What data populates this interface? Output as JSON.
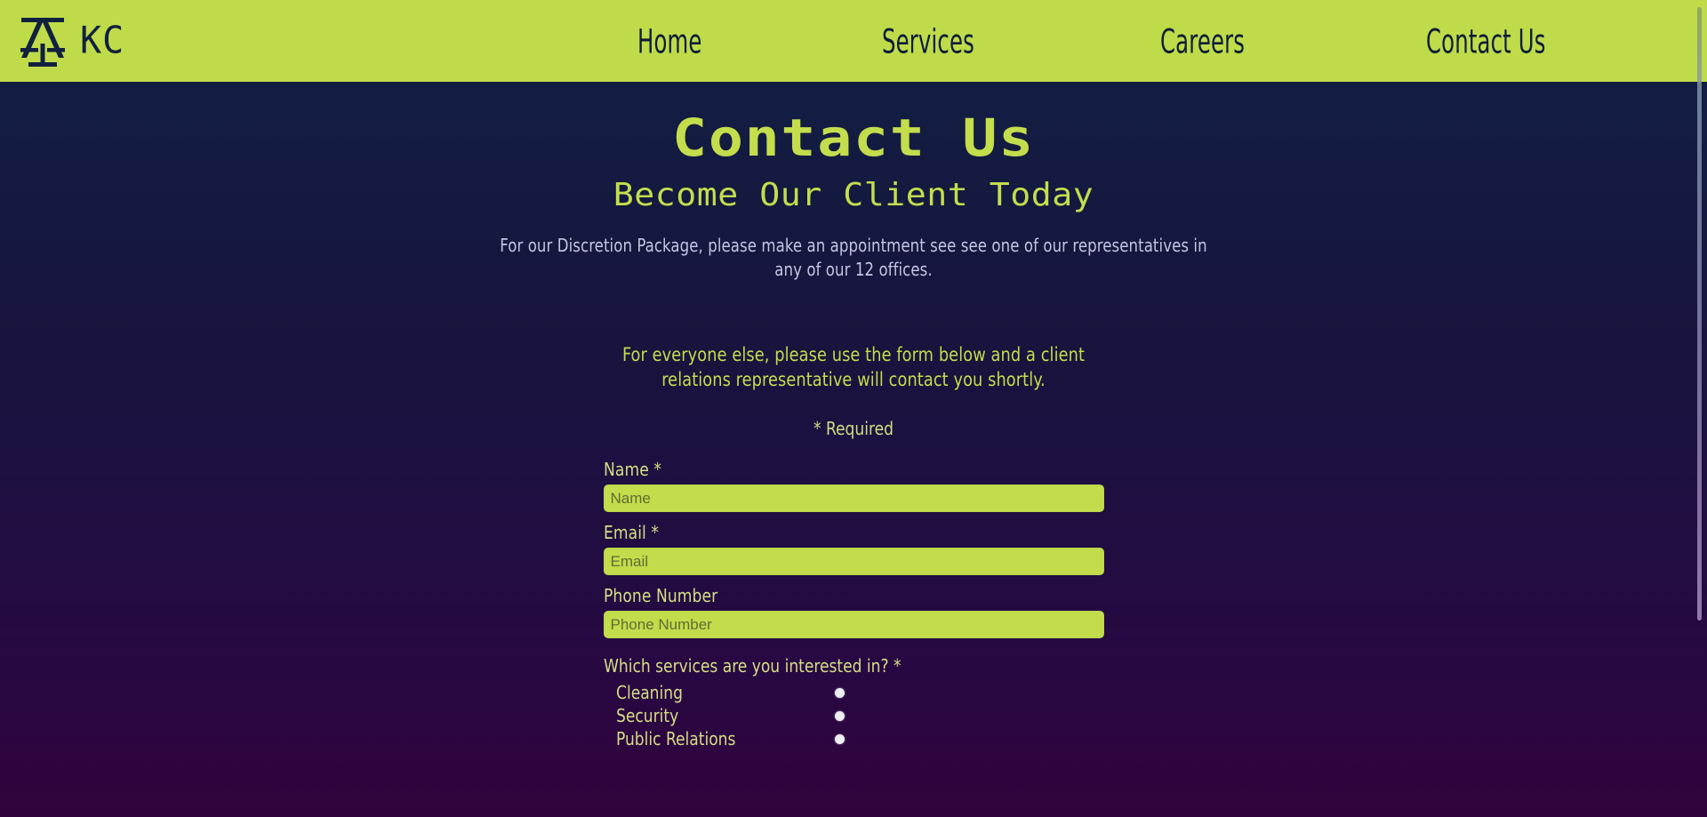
{
  "header": {
    "logo_icon": "scale-logo-icon",
    "brand_name": "KC",
    "brand_bg_color": "#BFDB4A",
    "brand_fg_color": "#12203F",
    "nav": [
      {
        "label": "Home",
        "name": "nav-home"
      },
      {
        "label": "Services",
        "name": "nav-services"
      },
      {
        "label": "Careers",
        "name": "nav-careers"
      },
      {
        "label": "Contact Us",
        "name": "nav-contact"
      }
    ]
  },
  "page": {
    "title": "Contact Us",
    "subtitle": "Become Our Client Today",
    "intro_paragraph": "For our Discretion Package, please make an appointment see see one of our representatives in any of our 12 offices.",
    "form_intro": "For everyone else, please use the form below and a client relations representative will contact you shortly.",
    "required_note": "* Required",
    "accent_green": "#C4DD4D",
    "label_color": "#D4DE84",
    "body_text_color": "#C3C6E2"
  },
  "form": {
    "fields": [
      {
        "label": "Name *",
        "placeholder": "Name",
        "value": "",
        "name": "name"
      },
      {
        "label": "Email *",
        "placeholder": "Email",
        "value": "",
        "name": "email"
      },
      {
        "label": "Phone Number",
        "placeholder": "Phone Number",
        "value": "",
        "name": "phone"
      }
    ],
    "services_question": "Which services are you interested in? *",
    "services_options": [
      {
        "label": "Cleaning",
        "selected": false
      },
      {
        "label": "Security",
        "selected": false
      },
      {
        "label": "Public Relations",
        "selected": false
      }
    ]
  }
}
